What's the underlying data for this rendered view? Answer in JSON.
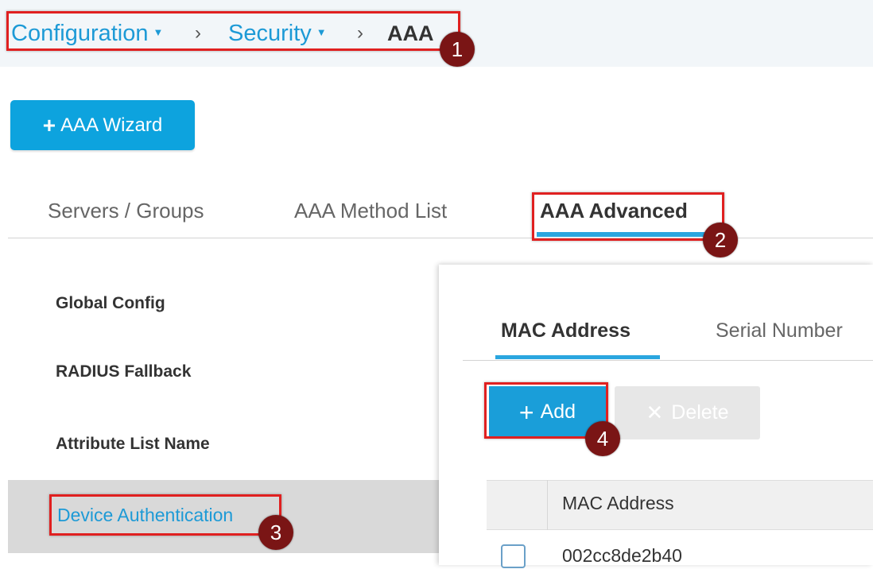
{
  "breadcrumb": {
    "items": [
      {
        "label": "Configuration",
        "caret": "▼"
      },
      {
        "label": "Security",
        "caret": "▼"
      }
    ],
    "separator": "›",
    "current": "AAA"
  },
  "toolbar": {
    "wizard_icon": "+",
    "wizard_label": "AAA Wizard"
  },
  "main_tabs": [
    {
      "label": "Servers / Groups"
    },
    {
      "label": "AAA Method List"
    },
    {
      "label": "AAA Advanced",
      "active": true
    }
  ],
  "sidebar": {
    "items": [
      {
        "label": "Global Config"
      },
      {
        "label": "RADIUS Fallback"
      },
      {
        "label": "Attribute List Name"
      },
      {
        "label": "Device Authentication",
        "active": true
      }
    ]
  },
  "panel": {
    "sub_tabs": [
      {
        "label": "MAC Address",
        "active": true
      },
      {
        "label": "Serial Number"
      }
    ],
    "add_icon": "+",
    "add_label": "Add",
    "delete_icon": "✕",
    "delete_label": "Delete",
    "table": {
      "columns": [
        "MAC Address"
      ],
      "rows": [
        [
          "002cc8de2b40"
        ]
      ]
    }
  },
  "callouts": [
    "1",
    "2",
    "3",
    "4"
  ],
  "colors": {
    "accent": "#1d9ad6",
    "button": "#0da3de",
    "callout_box": "#e02020",
    "callout_badge": "#7a1515",
    "active_nav_bg": "#d9d9d9"
  }
}
